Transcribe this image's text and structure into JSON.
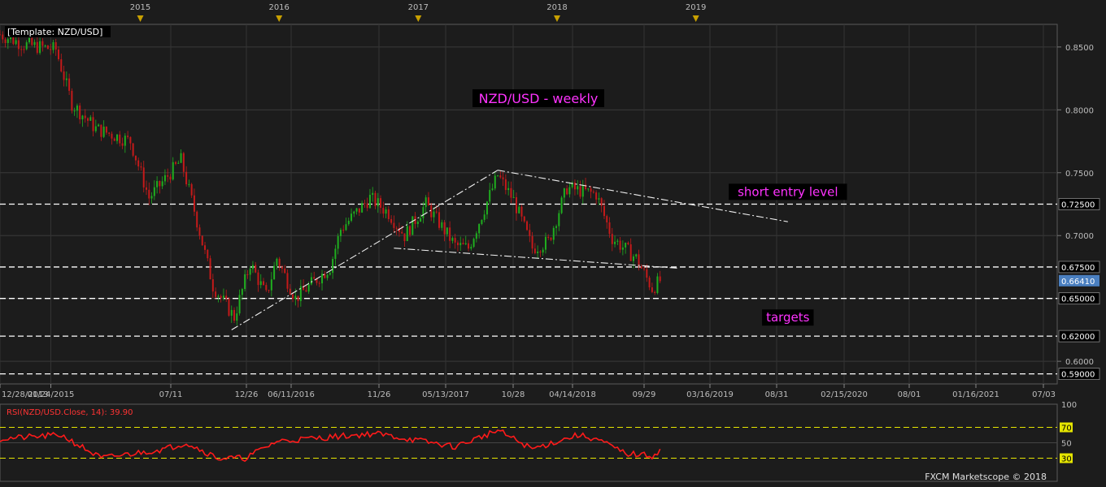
{
  "template_label": "[Template: NZD/USD]",
  "watermark": "FXCM Marketscope © 2018",
  "year_markers": [
    "2015",
    "2016",
    "2017",
    "2018",
    "2019"
  ],
  "date_ticks": [
    "12/28/2013",
    "01/24/2015",
    "07/11",
    "12/26",
    "06/11/2016",
    "11/26",
    "05/13/2017",
    "10/28",
    "04/14/2018",
    "09/29",
    "03/16/2019",
    "08/31",
    "02/15/2020",
    "08/01",
    "01/16/2021",
    "07/03"
  ],
  "colors": {
    "background": "#1c1c1c",
    "up_candle": "#1fae1f",
    "down_candle": "#c41a1a",
    "rsi_line": "#ff1a1a",
    "rsi_level": "#e6e600",
    "annotation": "#ff33ff",
    "last_price_bg": "#4a7fc0"
  },
  "chart_data": [
    {
      "type": "candlestick",
      "title": "NZD/USD - weekly",
      "y_ticks": [
        "0.6000",
        "0.6500",
        "0.7000",
        "0.7500",
        "0.8000",
        "0.8500"
      ],
      "ylim": [
        0.582,
        0.868
      ],
      "grid": true,
      "series_close_start": 0.86,
      "close_path": [
        {
          "date": "2013-12-28",
          "close": 0.86
        },
        {
          "date": "2014-03-01",
          "close": 0.852
        },
        {
          "date": "2014-05-24",
          "close": 0.848
        },
        {
          "date": "2014-07-05",
          "close": 0.805
        },
        {
          "date": "2014-09-06",
          "close": 0.785
        },
        {
          "date": "2014-12-06",
          "close": 0.775
        },
        {
          "date": "2015-01-24",
          "close": 0.73
        },
        {
          "date": "2015-04-18",
          "close": 0.76
        },
        {
          "date": "2015-05-23",
          "close": 0.72
        },
        {
          "date": "2015-07-11",
          "close": 0.66
        },
        {
          "date": "2015-09-05",
          "close": 0.635
        },
        {
          "date": "2015-10-17",
          "close": 0.678
        },
        {
          "date": "2015-11-28",
          "close": 0.652
        },
        {
          "date": "2015-12-26",
          "close": 0.682
        },
        {
          "date": "2016-02-13",
          "close": 0.65
        },
        {
          "date": "2016-05-14",
          "close": 0.675
        },
        {
          "date": "2016-06-11",
          "close": 0.705
        },
        {
          "date": "2016-08-27",
          "close": 0.73
        },
        {
          "date": "2016-10-15",
          "close": 0.718
        },
        {
          "date": "2016-11-26",
          "close": 0.7
        },
        {
          "date": "2017-01-21",
          "close": 0.725
        },
        {
          "date": "2017-04-08",
          "close": 0.692
        },
        {
          "date": "2017-05-13",
          "close": 0.69
        },
        {
          "date": "2017-07-29",
          "close": 0.748
        },
        {
          "date": "2017-09-09",
          "close": 0.728
        },
        {
          "date": "2017-10-28",
          "close": 0.69
        },
        {
          "date": "2017-12-09",
          "close": 0.695
        },
        {
          "date": "2018-01-27",
          "close": 0.738
        },
        {
          "date": "2018-04-14",
          "close": 0.733
        },
        {
          "date": "2018-05-26",
          "close": 0.698
        },
        {
          "date": "2018-07-28",
          "close": 0.682
        },
        {
          "date": "2018-09-08",
          "close": 0.658
        },
        {
          "date": "2018-09-29",
          "close": 0.664
        }
      ],
      "horizontal_levels": [
        {
          "value": 0.725,
          "label": "0.72500",
          "highlight": true
        },
        {
          "value": 0.675,
          "label": "0.67500",
          "highlight": true
        },
        {
          "value": 0.65,
          "label": "0.65000",
          "highlight": true
        },
        {
          "value": 0.62,
          "label": "0.62000",
          "highlight": true
        },
        {
          "value": 0.59,
          "label": "0.59000",
          "highlight": true
        }
      ],
      "last_price": {
        "value": 0.6641,
        "label": "0.66410"
      },
      "trendlines": [
        {
          "from": {
            "date": "2015-08-29",
            "value": 0.625
          },
          "to": {
            "date": "2017-07-29",
            "value": 0.752
          }
        },
        {
          "from": {
            "date": "2017-07-29",
            "value": 0.752
          },
          "to": {
            "date": "2019-08-31",
            "value": 0.711
          }
        },
        {
          "from": {
            "date": "2016-10-29",
            "value": 0.69
          },
          "to": {
            "date": "2018-11-17",
            "value": 0.674
          }
        }
      ],
      "annotations": [
        {
          "text": "short entry level",
          "date": "2019-08-31",
          "value": 0.7335
        },
        {
          "text": "targets",
          "date": "2019-08-31",
          "value": 0.6335
        }
      ]
    },
    {
      "type": "line",
      "title": "RSI(NZD/USD.Close, 14): 39.90",
      "y_ticks": [
        "100",
        "70",
        "50",
        "30"
      ],
      "ylim": [
        0,
        100
      ],
      "levels": [
        70,
        30
      ],
      "values_path": [
        {
          "date": "2013-12-28",
          "value": 55
        },
        {
          "date": "2014-06-07",
          "value": 60
        },
        {
          "date": "2014-09-20",
          "value": 30
        },
        {
          "date": "2015-03-07",
          "value": 42
        },
        {
          "date": "2015-05-02",
          "value": 50
        },
        {
          "date": "2015-07-25",
          "value": 30
        },
        {
          "date": "2015-10-03",
          "value": 30
        },
        {
          "date": "2015-12-26",
          "value": 52
        },
        {
          "date": "2016-09-10",
          "value": 62
        },
        {
          "date": "2017-04-08",
          "value": 45
        },
        {
          "date": "2017-07-29",
          "value": 66
        },
        {
          "date": "2017-10-28",
          "value": 42
        },
        {
          "date": "2018-02-24",
          "value": 60
        },
        {
          "date": "2018-04-14",
          "value": 55
        },
        {
          "date": "2018-06-30",
          "value": 36
        },
        {
          "date": "2018-09-08",
          "value": 33
        },
        {
          "date": "2018-09-29",
          "value": 39.9
        }
      ]
    }
  ]
}
